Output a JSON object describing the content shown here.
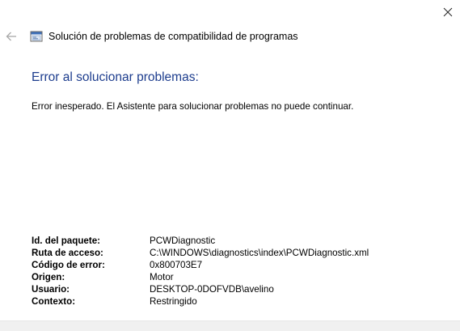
{
  "window": {
    "title": "Solución de problemas de compatibilidad de programas"
  },
  "icons": {
    "close": "close-icon",
    "back": "back-arrow-icon",
    "app": "troubleshooter-app-icon"
  },
  "colors": {
    "heading": "#1d3d8e",
    "footer": "#f0f0f0"
  },
  "main": {
    "heading": "Error al solucionar problemas:",
    "message": "Error inesperado. El Asistente para solucionar problemas no puede continuar."
  },
  "details": [
    {
      "label": "Id. del paquete:",
      "value": "PCWDiagnostic"
    },
    {
      "label": "Ruta de acceso:",
      "value": "C:\\WINDOWS\\diagnostics\\index\\PCWDiagnostic.xml"
    },
    {
      "label": "Código de error:",
      "value": "0x800703E7"
    },
    {
      "label": "Origen:",
      "value": "Motor"
    },
    {
      "label": "Usuario:",
      "value": "DESKTOP-0DOFVDB\\avelino"
    },
    {
      "label": "Contexto:",
      "value": "Restringido"
    }
  ]
}
